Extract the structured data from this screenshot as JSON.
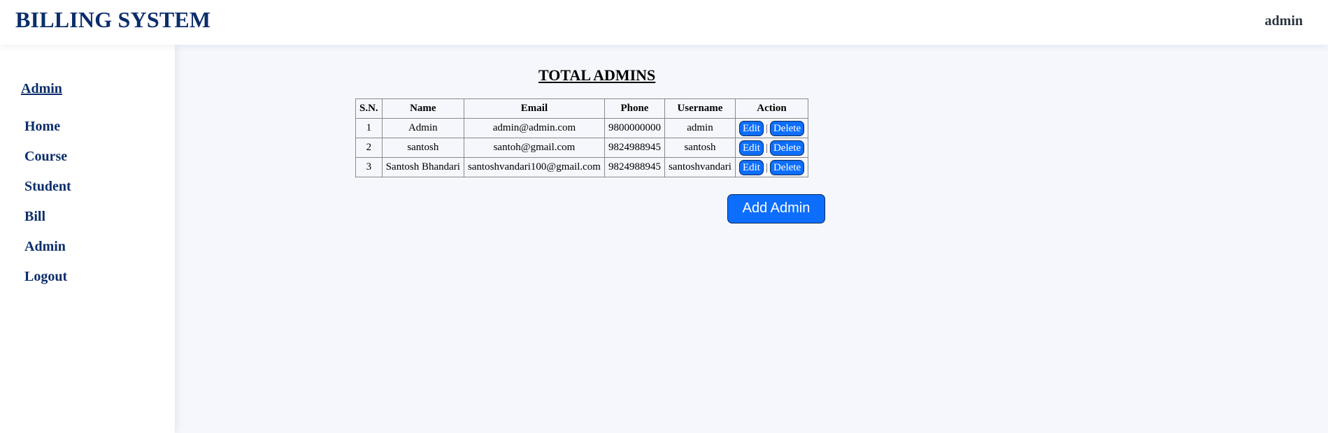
{
  "header": {
    "title": "BILLING SYSTEM",
    "user": "admin"
  },
  "sidebar": {
    "title": "Admin",
    "items": [
      {
        "label": "Home"
      },
      {
        "label": "Course"
      },
      {
        "label": "Student"
      },
      {
        "label": "Bill"
      },
      {
        "label": "Admin"
      },
      {
        "label": "Logout"
      }
    ]
  },
  "main": {
    "title": "TOTAL ADMINS",
    "table": {
      "columns": [
        "S.N.",
        "Name",
        "Email",
        "Phone",
        "Username",
        "Action"
      ],
      "rows": [
        {
          "sn": "1",
          "name": "Admin",
          "email": "admin@admin.com",
          "phone": "9800000000",
          "username": "admin"
        },
        {
          "sn": "2",
          "name": "santosh",
          "email": "santoh@gmail.com",
          "phone": "9824988945",
          "username": "santosh"
        },
        {
          "sn": "3",
          "name": "Santosh Bhandari",
          "email": "santoshvandari100@gmail.com",
          "phone": "9824988945",
          "username": "santoshvandari"
        }
      ],
      "edit_label": "Edit",
      "delete_label": "Delete",
      "separator": "|"
    },
    "add_button": "Add Admin"
  },
  "colors": {
    "brand": "#0b2e6b",
    "button": "#0d6efd",
    "background": "#f5f7fc"
  }
}
